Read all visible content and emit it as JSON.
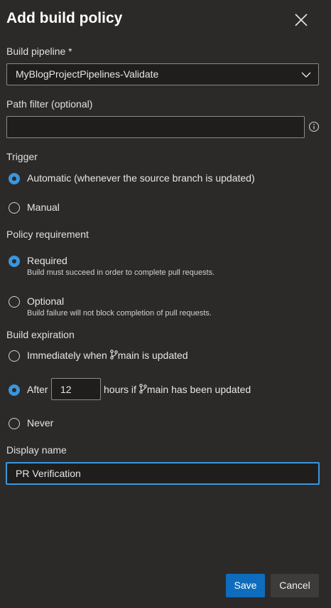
{
  "dialog": {
    "title": "Add build policy"
  },
  "build_pipeline": {
    "label": "Build pipeline *",
    "selected": "MyBlogProjectPipelines-Validate"
  },
  "path_filter": {
    "label": "Path filter (optional)",
    "value": ""
  },
  "trigger": {
    "label": "Trigger",
    "options": [
      {
        "label": "Automatic (whenever the source branch is updated)",
        "selected": true
      },
      {
        "label": "Manual",
        "selected": false
      }
    ]
  },
  "policy_requirement": {
    "label": "Policy requirement",
    "options": [
      {
        "label": "Required",
        "description": "Build must succeed in order to complete pull requests.",
        "selected": true
      },
      {
        "label": "Optional",
        "description": "Build failure will not block completion of pull requests.",
        "selected": false
      }
    ]
  },
  "build_expiration": {
    "label": "Build expiration",
    "immediately": {
      "prefix": "Immediately when",
      "branch": "main",
      "suffix": "is updated",
      "selected": false
    },
    "after": {
      "prefix": "After",
      "hours": "12",
      "middle": "hours if",
      "branch": "main",
      "suffix": "has been updated",
      "selected": true
    },
    "never": {
      "label": "Never",
      "selected": false
    }
  },
  "display_name": {
    "label": "Display name",
    "value": "PR Verification"
  },
  "buttons": {
    "save": "Save",
    "cancel": "Cancel"
  },
  "colors": {
    "accent": "#3a96dd",
    "primary_button": "#0f6cbd",
    "background": "#2b2a29"
  }
}
